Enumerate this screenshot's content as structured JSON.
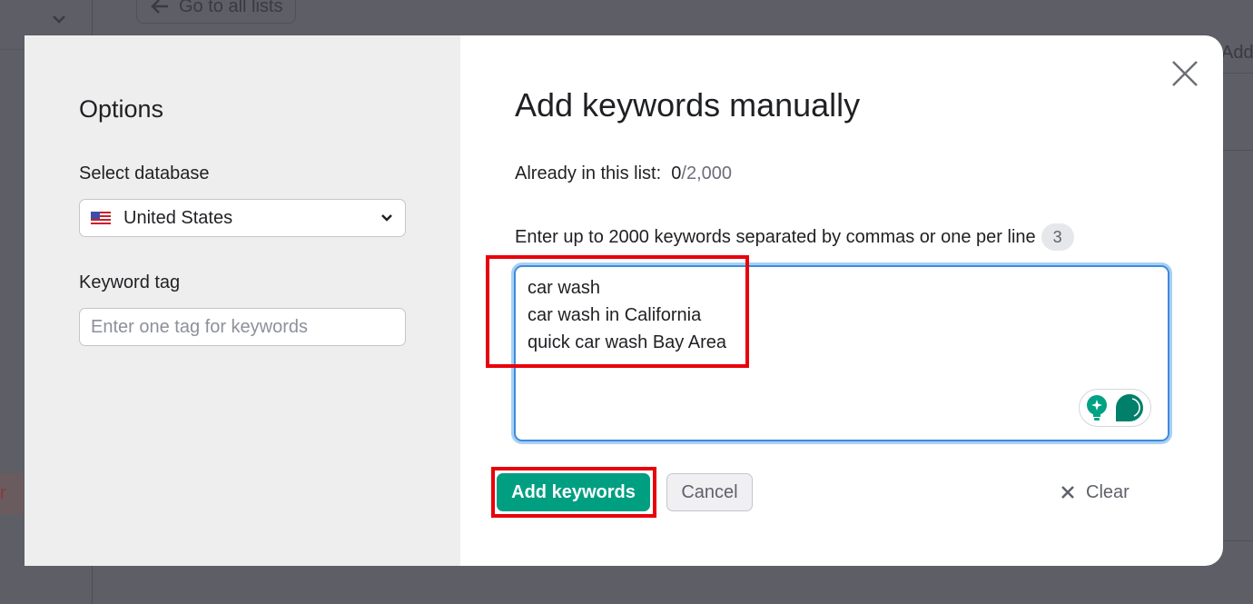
{
  "background": {
    "back_button_label": "Go to all lists",
    "right_partial_text": "Add",
    "left_partial_text": "r"
  },
  "modal": {
    "options": {
      "title": "Options",
      "database_label": "Select database",
      "database_value": "United States",
      "database_flag": "us-flag-icon",
      "tag_label": "Keyword tag",
      "tag_placeholder": "Enter one tag for keywords",
      "tag_value": ""
    },
    "main": {
      "title": "Add keywords manually",
      "count_label": "Already in this list:",
      "count_current": "0",
      "count_total": "/2,000",
      "instructions": "Enter up to 2000 keywords separated by commas or one per line",
      "keyword_count_badge": "3",
      "keywords_value": "car wash\ncar wash in California\nquick car wash Bay Area",
      "ai_icons": [
        "lightbulb-sparkle-icon",
        "chat-bubble-icon"
      ]
    },
    "actions": {
      "add_label": "Add keywords",
      "cancel_label": "Cancel",
      "clear_label": "Clear"
    },
    "colors": {
      "primary": "#009f81",
      "focus_border": "#3f8cd9",
      "highlight": "#e8000b"
    }
  }
}
